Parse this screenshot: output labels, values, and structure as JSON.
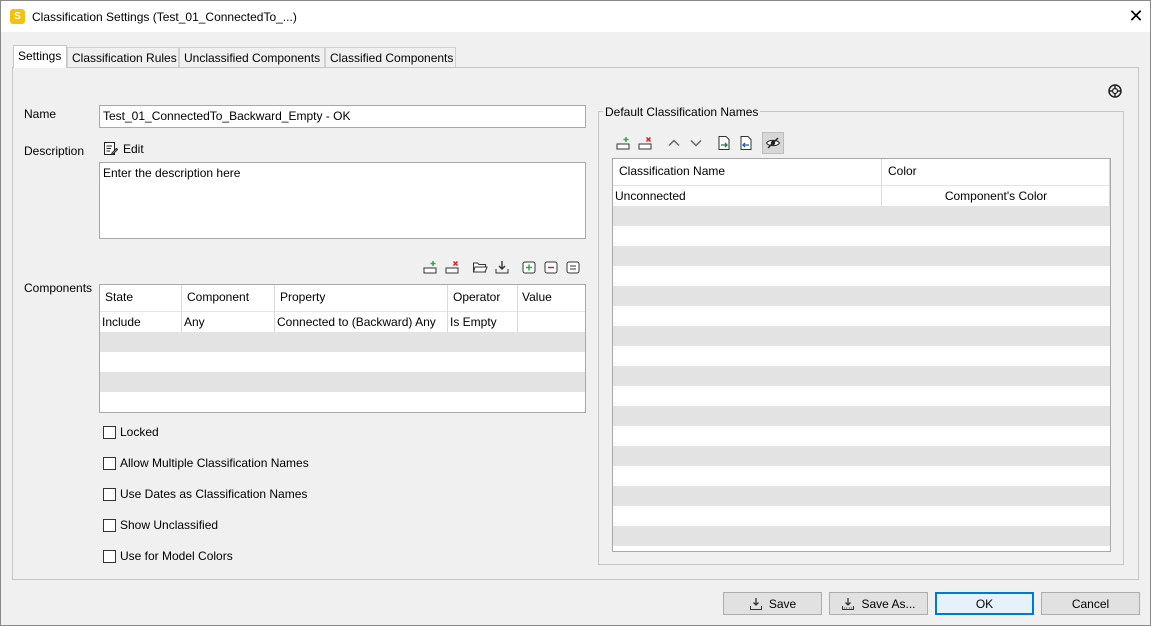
{
  "window": {
    "title": "Classification Settings (Test_01_ConnectedTo_...)",
    "app_icon_letter": "S",
    "close_glyph": "✕"
  },
  "tabs": [
    "Settings",
    "Classification Rules",
    "Unclassified Components",
    "Classified Components"
  ],
  "settings": {
    "name_label": "Name",
    "name_value": "Test_01_ConnectedTo_Backward_Empty - OK",
    "description_label": "Description",
    "edit_label": "Edit",
    "description_text": "Enter the description here",
    "components_label": "Components",
    "components_columns": [
      "State",
      "Component",
      "Property",
      "Operator",
      "Value"
    ],
    "components_rows": [
      [
        "Include",
        "Any",
        "Connected to (Backward) Any",
        "Is Empty",
        ""
      ]
    ],
    "checkboxes": [
      "Locked",
      "Allow Multiple Classification Names",
      "Use Dates as Classification Names",
      "Show Unclassified",
      "Use for Model Colors"
    ]
  },
  "default_names": {
    "group_title": "Default Classification Names",
    "columns": [
      "Classification Name",
      "Color"
    ],
    "rows": [
      [
        "Unconnected",
        "Component's Color"
      ]
    ]
  },
  "footer": {
    "save": "Save",
    "save_as": "Save As...",
    "ok": "OK",
    "cancel": "Cancel"
  },
  "icons": {
    "app": "app-logo-icon",
    "help": "lifebuoy-help-icon",
    "edit": "edit-document-icon",
    "add_row": "add-row-icon",
    "remove_row": "remove-row-icon",
    "open": "open-folder-icon",
    "download": "download-icon",
    "move_up": "chevron-up-icon",
    "move_down": "chevron-down-icon",
    "import": "import-excel-icon",
    "export": "export-excel-icon",
    "hide": "eye-hidden-icon"
  },
  "colors": {
    "accent": "#0078d7",
    "alt_row": "#e3e3e3",
    "app_icon": "#f4c20d",
    "add_green": "#2fa84f",
    "remove_red": "#d02020"
  }
}
